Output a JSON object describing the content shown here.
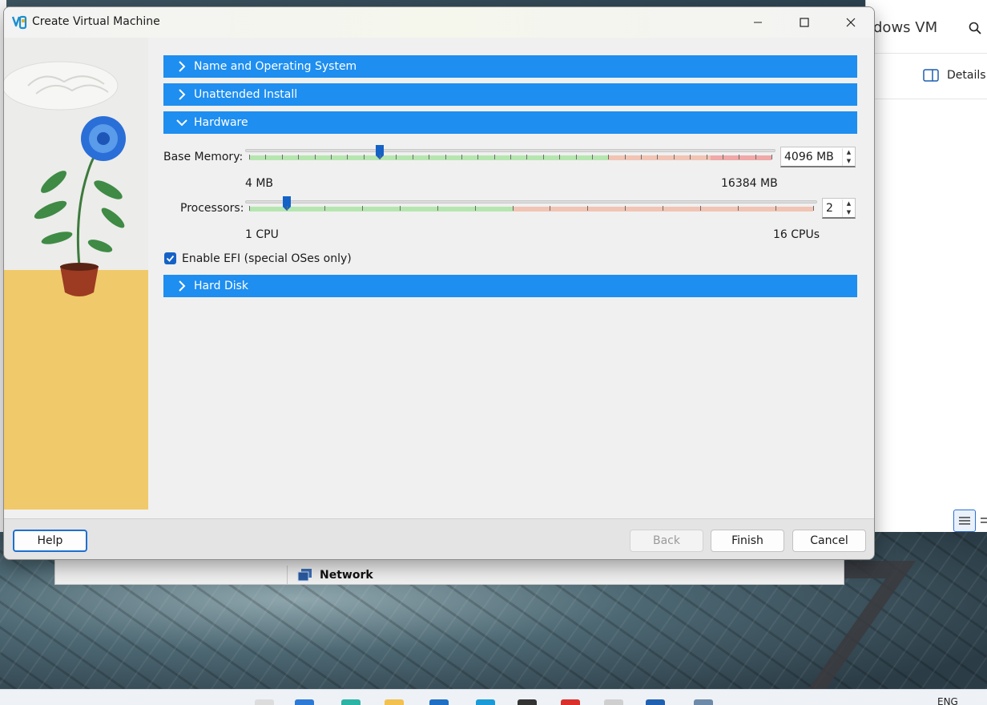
{
  "dialog": {
    "title": "Create Virtual Machine",
    "minimize_icon": "minimize-icon",
    "maximize_icon": "maximize-icon",
    "close_icon": "close-icon"
  },
  "sections": {
    "name_os": "Name and Operating System",
    "unattended": "Unattended Install",
    "hardware": "Hardware",
    "hard_disk": "Hard Disk"
  },
  "hardware": {
    "base_memory": {
      "label": "Base Memory:",
      "value": "4096 MB",
      "min_label": "4 MB",
      "max_label": "16384 MB",
      "min": 4,
      "max": 16384,
      "current": 4096
    },
    "processors": {
      "label": "Processors:",
      "value": "2",
      "min_label": "1 CPU",
      "max_label": "16 CPUs",
      "min": 1,
      "max": 16,
      "current": 2
    },
    "efi": {
      "label": "Enable EFI (special OSes only)",
      "checked": true
    }
  },
  "buttons": {
    "help": "Help",
    "back": "Back",
    "finish": "Finish",
    "cancel": "Cancel"
  },
  "background": {
    "window_title_fragment": "dows VM",
    "details": "Details",
    "network": "Network",
    "language": "ENG"
  },
  "colors": {
    "accent": "#1e8ef0",
    "ok_zone": "#b6e6b0",
    "warn_zone": "#f2c4b4",
    "bad_zone": "#f0a8a8"
  }
}
